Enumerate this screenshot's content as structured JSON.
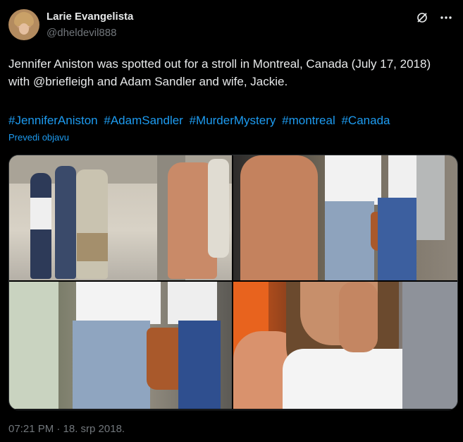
{
  "author": {
    "name": "Larie Evangelista",
    "handle": "@dheldevil888"
  },
  "tweet": {
    "text": "Jennifer Aniston was spotted out for a stroll in Montreal, Canada (July 17, 2018) with  @briefleigh and Adam Sandler and wife, Jackie.",
    "hashtags": [
      "#JenniferAniston",
      "#AdamSandler",
      "#MurderMystery",
      "#montreal",
      "#Canada"
    ],
    "translate_label": "Prevedi objavu",
    "timestamp": "07:21 PM · 18. srp 2018."
  },
  "icons": {
    "grok": "grok-icon",
    "more": "more-icon"
  },
  "colors": {
    "background": "#000000",
    "text": "#e7e9ea",
    "muted": "#71767b",
    "link": "#1d9bf0"
  }
}
